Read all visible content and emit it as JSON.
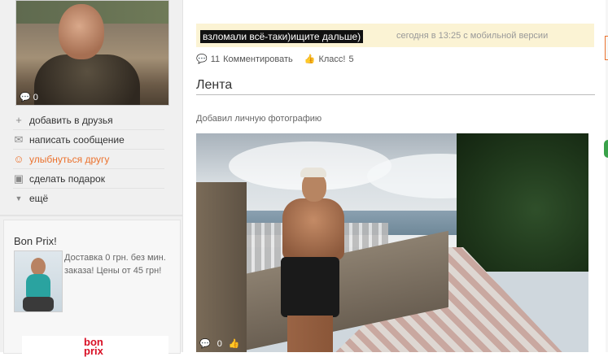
{
  "profile": {
    "photo_comment_count": "0",
    "menu": [
      {
        "icon": "plus-icon",
        "label": "добавить в друзья"
      },
      {
        "icon": "envelope-icon",
        "label": "написать сообщение"
      },
      {
        "icon": "smile-icon",
        "label": "улыбнуться другу"
      },
      {
        "icon": "gift-icon",
        "label": "сделать подарок"
      },
      {
        "icon": "triangle-down-icon",
        "label": "ещё"
      }
    ]
  },
  "ad": {
    "title": "Bon Prix!",
    "text": "Доставка 0 грн. без мин. заказа! Цены от 45 грн!",
    "logo_line1": "bon",
    "logo_line2": "prix"
  },
  "status": {
    "text": "взломали всё-таки)ищите дальше)",
    "meta": "сегодня в 13:25  с мобильной версии",
    "comments_count": "11",
    "comment_label": "Комментировать",
    "class_label": "Класс!",
    "class_count": "5"
  },
  "feed": {
    "title": "Лента",
    "added_text": "Добавил личную фотографию",
    "photo_comment_count": "0"
  },
  "colors": {
    "accent": "#eb722e",
    "status_bg": "#fbf3d4"
  }
}
